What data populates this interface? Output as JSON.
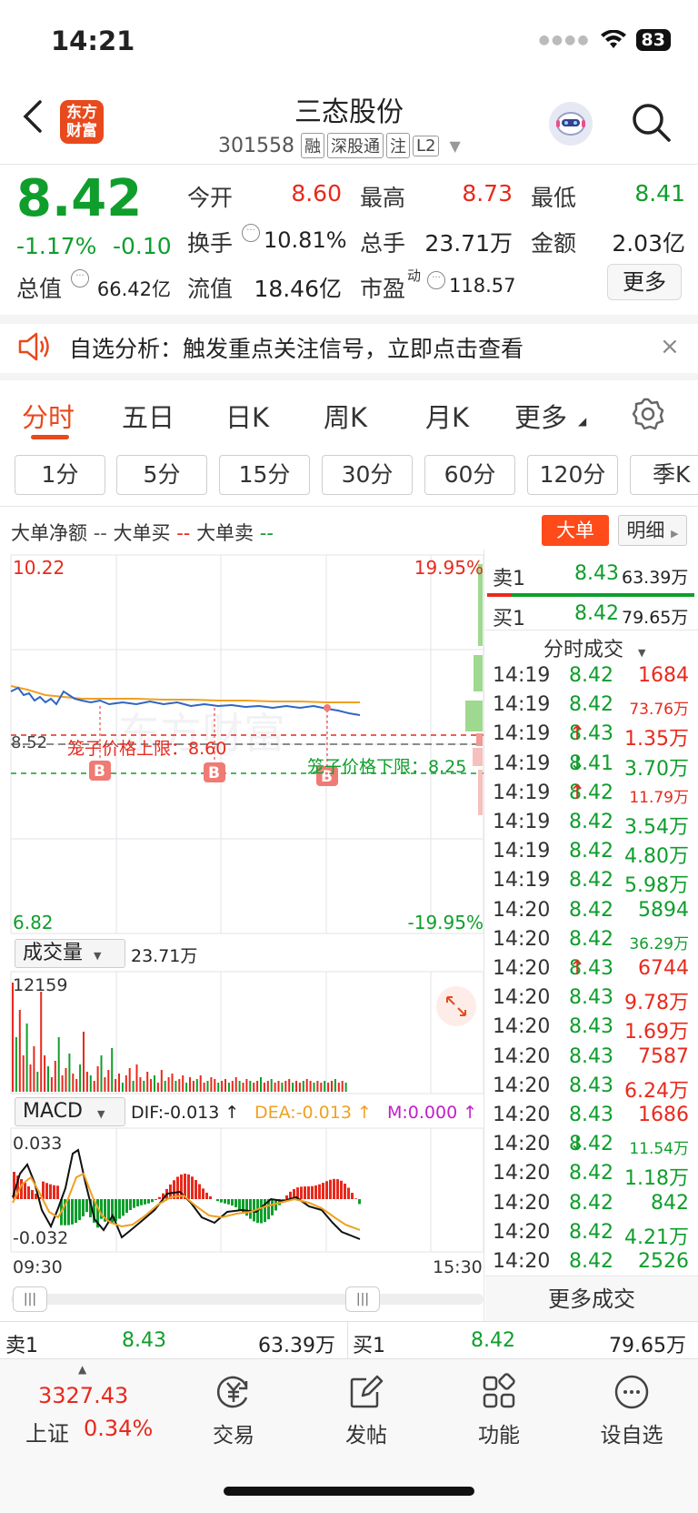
{
  "status": {
    "time": "14:21",
    "battery": "83"
  },
  "header": {
    "logo_line1": "东方",
    "logo_line2": "财富",
    "title": "三态股份",
    "code": "301558",
    "tags": [
      "融",
      "深股通",
      "注",
      "L2"
    ]
  },
  "quote": {
    "price": "8.42",
    "change_pct": "-1.17%",
    "change": "-0.10",
    "open_label": "今开",
    "open": "8.60",
    "high_label": "最高",
    "high": "8.73",
    "low_label": "最低",
    "low": "8.41",
    "turnover_label": "换手",
    "turnover": "10.81%",
    "volume_label": "总手",
    "volume": "23.71万",
    "amount_label": "金额",
    "amount": "2.03亿",
    "mktcap_label": "总值",
    "mktcap": "66.42亿",
    "float_label": "流值",
    "float": "18.46亿",
    "pe_label": "市盈",
    "pe_sup": "动",
    "pe": "118.57",
    "more": "更多"
  },
  "banner": {
    "text": "自选分析：触发重点关注信号，立即点击查看",
    "close": "×"
  },
  "tabs": [
    "分时",
    "五日",
    "日K",
    "周K",
    "月K",
    "更多"
  ],
  "periods": [
    "1分",
    "5分",
    "15分",
    "30分",
    "60分",
    "120分",
    "季K"
  ],
  "legend": {
    "net": "大单净额",
    "net_mark": "--",
    "buy": "大单买",
    "buy_mark": "--",
    "sell": "大单卖",
    "sell_mark": "--"
  },
  "buttons": {
    "dadan": "大单",
    "mingxi": "明细"
  },
  "chart": {
    "y_top_left": "10.22",
    "y_top_right": "19.95%",
    "y_bottom_left": "6.82",
    "y_bottom_right": "-19.95%",
    "prev_close": "8.52",
    "upper_limit_label": "笼子价格上限：8.60",
    "lower_limit_label": "笼子价格下限：8.25",
    "b_markers": [
      "B",
      "B",
      "B"
    ],
    "watermark": "东方财富",
    "volume_label": "成交量",
    "volume_total": "23.71万",
    "volume_max": "12159",
    "macd_label": "MACD",
    "dif": "DIF:-0.013 ↑",
    "dea": "DEA:-0.013 ↑",
    "m": "M:0.000 ↑",
    "macd_top": "0.033",
    "macd_bottom": "-0.032",
    "time_start": "09:30",
    "time_end": "15:30",
    "colors": {
      "up": "#e8291c",
      "down": "#0f9e2c",
      "price_line": "#2f66c4",
      "avg_line": "#f0a020"
    }
  },
  "order_book": {
    "sell1_label": "卖1",
    "sell1_price": "8.43",
    "sell1_vol": "63.39万",
    "buy1_label": "买1",
    "buy1_price": "8.42",
    "buy1_vol": "79.65万"
  },
  "trades_title": "分时成交",
  "trades": [
    {
      "time": "14:19",
      "price": "8.42",
      "arrow": "",
      "vol": "1684",
      "pc": "green",
      "vc": "red"
    },
    {
      "time": "14:19",
      "price": "8.42",
      "arrow": "",
      "vol": "73.76万",
      "pc": "green",
      "vc": "red"
    },
    {
      "time": "14:19",
      "price": "8.43",
      "arrow": "↑",
      "vol": "1.35万",
      "pc": "green",
      "vc": "red"
    },
    {
      "time": "14:19",
      "price": "8.41",
      "arrow": "↓",
      "vol": "3.70万",
      "pc": "green",
      "vc": "green"
    },
    {
      "time": "14:19",
      "price": "8.42",
      "arrow": "↑",
      "vol": "11.79万",
      "pc": "green",
      "vc": "red"
    },
    {
      "time": "14:19",
      "price": "8.42",
      "arrow": "",
      "vol": "3.54万",
      "pc": "green",
      "vc": "green"
    },
    {
      "time": "14:19",
      "price": "8.42",
      "arrow": "",
      "vol": "4.80万",
      "pc": "green",
      "vc": "green"
    },
    {
      "time": "14:19",
      "price": "8.42",
      "arrow": "",
      "vol": "5.98万",
      "pc": "green",
      "vc": "green"
    },
    {
      "time": "14:20",
      "price": "8.42",
      "arrow": "",
      "vol": "5894",
      "pc": "green",
      "vc": "green"
    },
    {
      "time": "14:20",
      "price": "8.42",
      "arrow": "",
      "vol": "36.29万",
      "pc": "green",
      "vc": "green"
    },
    {
      "time": "14:20",
      "price": "8.43",
      "arrow": "↑",
      "vol": "6744",
      "pc": "green",
      "vc": "red"
    },
    {
      "time": "14:20",
      "price": "8.43",
      "arrow": "",
      "vol": "9.78万",
      "pc": "green",
      "vc": "red"
    },
    {
      "time": "14:20",
      "price": "8.43",
      "arrow": "",
      "vol": "1.69万",
      "pc": "green",
      "vc": "red"
    },
    {
      "time": "14:20",
      "price": "8.43",
      "arrow": "",
      "vol": "7587",
      "pc": "green",
      "vc": "red"
    },
    {
      "time": "14:20",
      "price": "8.43",
      "arrow": "",
      "vol": "6.24万",
      "pc": "green",
      "vc": "red"
    },
    {
      "time": "14:20",
      "price": "8.43",
      "arrow": "",
      "vol": "1686",
      "pc": "green",
      "vc": "red"
    },
    {
      "time": "14:20",
      "price": "8.42",
      "arrow": "↓",
      "vol": "11.54万",
      "pc": "green",
      "vc": "green"
    },
    {
      "time": "14:20",
      "price": "8.42",
      "arrow": "",
      "vol": "1.18万",
      "pc": "green",
      "vc": "green"
    },
    {
      "time": "14:20",
      "price": "8.42",
      "arrow": "",
      "vol": "842",
      "pc": "green",
      "vc": "green"
    },
    {
      "time": "14:20",
      "price": "8.42",
      "arrow": "",
      "vol": "4.21万",
      "pc": "green",
      "vc": "green"
    },
    {
      "time": "14:20",
      "price": "8.42",
      "arrow": "",
      "vol": "2526",
      "pc": "green",
      "vc": "green"
    }
  ],
  "more_trades": "更多成交",
  "footer": {
    "index_value": "3327.43",
    "index_name": "上证",
    "index_pct": "0.34%",
    "nav": [
      "交易",
      "发帖",
      "功能",
      "设自选"
    ]
  }
}
